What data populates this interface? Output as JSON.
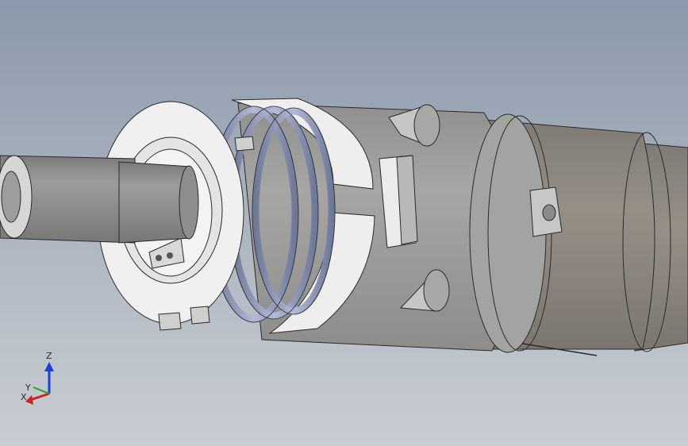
{
  "viewport": {
    "background_top": "#8a98ab",
    "background_bottom": "#c9cdd2",
    "model_colors": {
      "body": "#9a9a98",
      "face": "#efefef",
      "spring": "#8f97b8",
      "rear_housing": "#8d8880"
    }
  },
  "triad": {
    "z_label": "Z",
    "y_label": "Y",
    "x_label": "X",
    "z_color": "#1f3fd0",
    "x_color": "#d02020",
    "y_color": "#20a020"
  }
}
